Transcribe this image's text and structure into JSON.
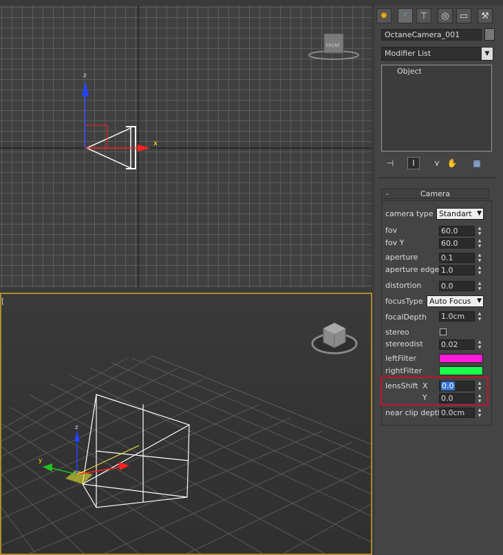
{
  "viewport_top": {
    "axis_label_z": "z",
    "axis_label_x": "x",
    "viewcube_label": "FRONT"
  },
  "viewport_perspective": {
    "label": "[",
    "axis_label_z": "z",
    "axis_label_y": "y"
  },
  "command_panel": {
    "tabs": [
      "create-icon",
      "modify-icon",
      "hierarchy-icon",
      "motion-icon",
      "display-icon",
      "utilities-icon"
    ],
    "object_name": "OctaneCamera_001",
    "modifier_list": "Modifier List",
    "stack_item": "Object",
    "stack_tools": [
      "pin-stack-icon",
      "show-end-result-icon",
      "make-unique-icon",
      "remove-modifier-icon",
      "configure-modifier-sets-icon"
    ]
  },
  "camera_rollout": {
    "collapse_symbol": "-",
    "title": "Camera",
    "camera_type_label": "camera type",
    "camera_type_value": "Standart",
    "fov_label": "fov",
    "fov_value": "60.0",
    "fovy_label": "fov Y",
    "fovy_value": "60.0",
    "aperture_label": "aperture",
    "aperture_value": "0.1",
    "aperture_edge_label": "aperture edge",
    "aperture_edge_value": "1.0",
    "distortion_label": "distortion",
    "distortion_value": "0.0",
    "focus_type_label": "focusType",
    "focus_type_value": "Auto Focus",
    "focal_depth_label": "focalDepth",
    "focal_depth_value": "1.0cm",
    "stereo_label": "stereo",
    "stereodist_label": "stereodist",
    "stereodist_value": "0.02",
    "left_filter_label": "leftFilter",
    "left_filter_color": "#ff1ad9",
    "right_filter_label": "rightFilter",
    "right_filter_color": "#1aff4a",
    "lens_shift_label": "lensShift",
    "lens_shift_x_label": "X",
    "lens_shift_x_value": "0.0",
    "lens_shift_y_label": "Y",
    "lens_shift_y_value": "0.0",
    "near_clip_label": "near clip depth",
    "near_clip_value": "0.0cm"
  }
}
